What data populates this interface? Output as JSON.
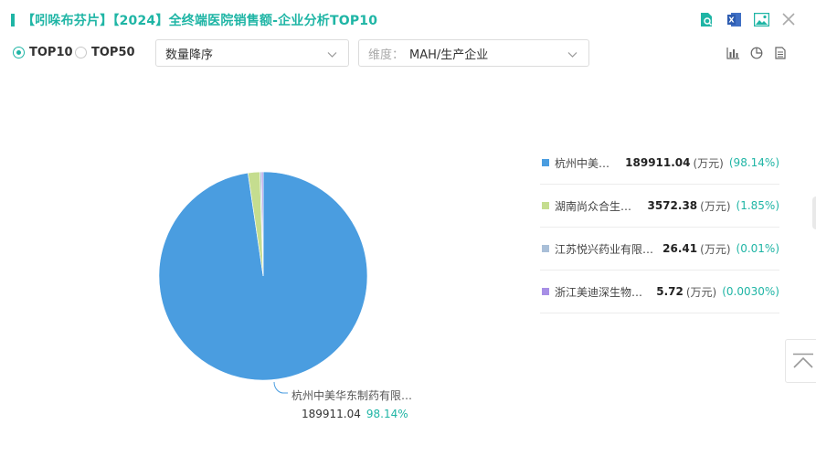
{
  "header": {
    "title": "【吲哚布芬片】【2024】全终端医院销售额-企业分析TOP10",
    "icons": [
      "search-doc-icon",
      "excel-export-icon",
      "image-export-icon",
      "close-icon"
    ]
  },
  "controls": {
    "radio_top10": "TOP10",
    "radio_top50": "TOP50",
    "selected_radio": "TOP10",
    "sort_select": "数量降序",
    "dim_label": "维度：",
    "dim_value": "MAH/生产企业",
    "view_icons": [
      "bar-chart-icon",
      "pie-chart-icon",
      "table-view-icon"
    ]
  },
  "colors": {
    "accent": "#1fb5a5",
    "series": [
      "#4a9de0",
      "#c5dd8f",
      "#a9bfd8",
      "#a78fe6"
    ]
  },
  "chart_data": {
    "type": "pie",
    "unit": "(万元)",
    "slices": [
      {
        "name": "杭州中美华东…",
        "full_label": "杭州中美华东制药有限…",
        "value": 189911.04,
        "value_text": "189911.04",
        "pct": "(98.14%)",
        "pct_plain": "98.14%"
      },
      {
        "name": "湖南尚众合生物…",
        "value": 3572.38,
        "value_text": "3572.38",
        "pct": "(1.85%)"
      },
      {
        "name": "江苏悦兴药业有限公司",
        "value": 26.41,
        "value_text": "26.41",
        "pct": "(0.01%)"
      },
      {
        "name": "浙江美迪深生物医…",
        "value": 5.72,
        "value_text": "5.72",
        "pct": "(0.0030%)"
      }
    ]
  }
}
